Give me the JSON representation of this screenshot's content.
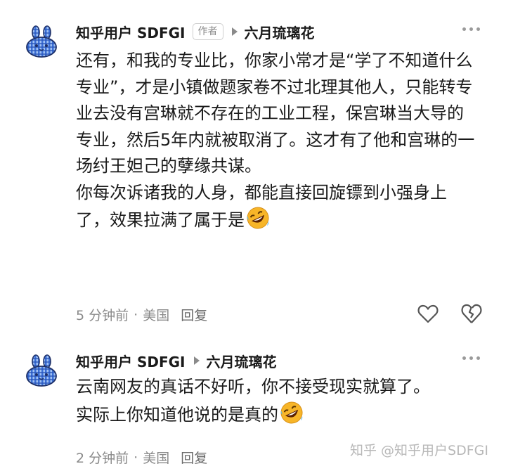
{
  "comments": [
    {
      "author": "知乎用户 SDFGI",
      "badge": "作者",
      "reply_to": "六月琉璃花",
      "body": [
        "还有，和我的专业比，你家小常才是“学了不知道什么专业”，才是小镇做题家卷不过北理其他人，只能转专业去没有宫琳就不存在的工业工程，保宫琳当大导的专业，然后5年内就被取消了。这才有了他和宫琳的一场纣王妲己的孽缘共谋。",
        "你每次诉诸我的人身，都能直接回旋镖到小强身上了，效果拉满了属于是"
      ],
      "time": "5 分钟前",
      "location": "美国",
      "reply_label": "回复"
    },
    {
      "author": "知乎用户 SDFGI",
      "reply_to": "六月琉璃花",
      "body": [
        "云南网友的真话不好听，你不接受现实就算了。",
        "实际上你知道他说的是真的"
      ],
      "time": "2 分钟前",
      "location": "美国",
      "reply_label": "回复"
    }
  ],
  "separator": "·",
  "watermark": "知乎 @知乎用户SDFGI",
  "icons": {
    "avatar": "blue-plaid-bunny-avatar",
    "emoji": "rolling-on-floor-laughing-emoji",
    "more": "more-dots-icon",
    "like": "heart-icon",
    "dislike": "broken-heart-icon",
    "arrow": "reply-arrow-icon"
  },
  "colors": {
    "text": "#1a1a1a",
    "meta": "#8a8a8a",
    "avatar_blue": "#3b6fd6",
    "emoji_yellow": "#f7b528"
  }
}
